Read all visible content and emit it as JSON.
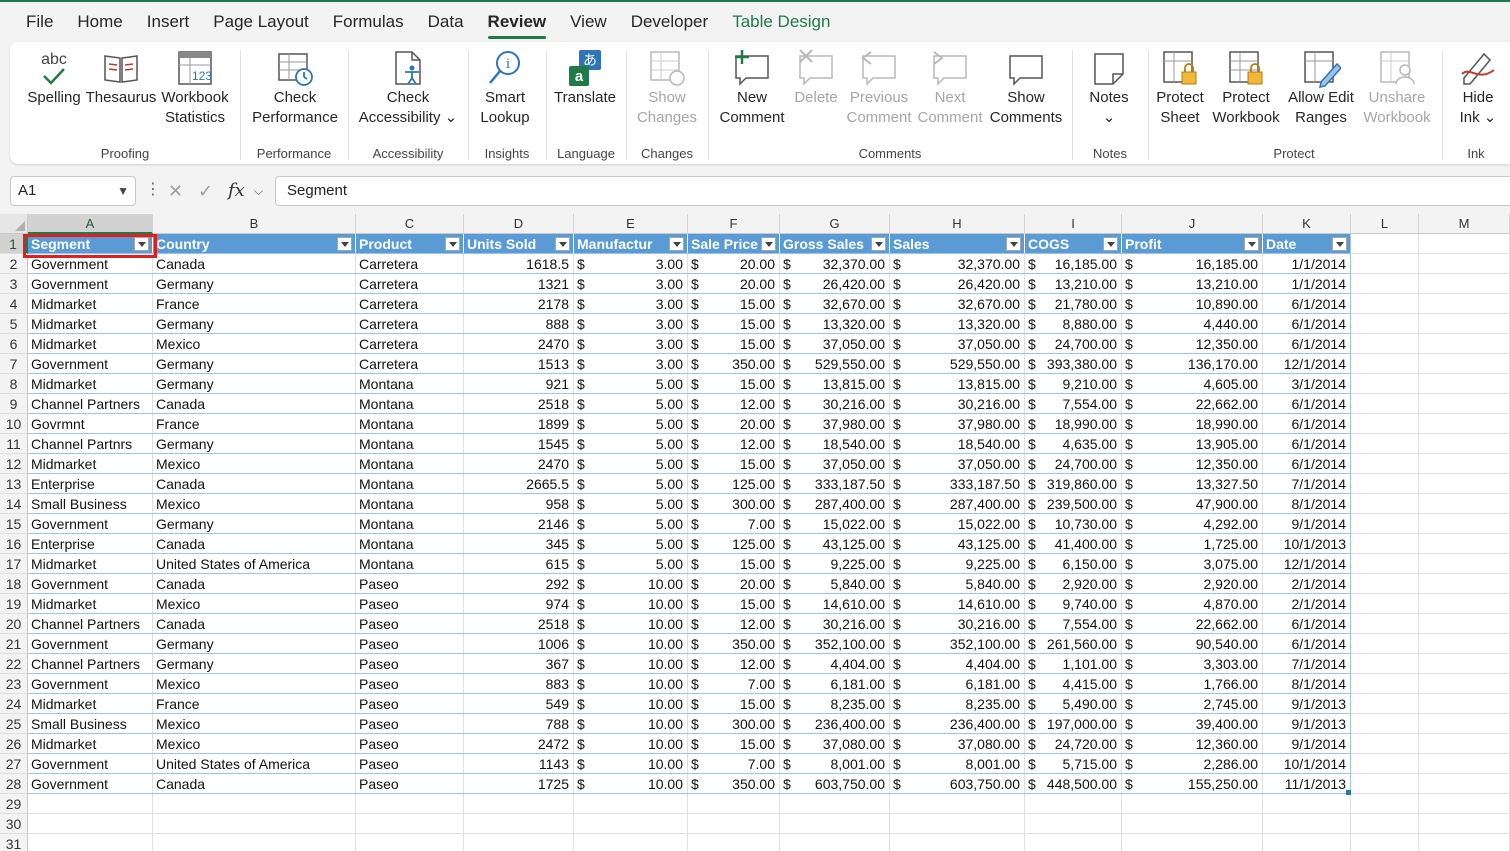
{
  "menu": {
    "tabs": [
      "File",
      "Home",
      "Insert",
      "Page Layout",
      "Formulas",
      "Data",
      "Review",
      "View",
      "Developer",
      "Table Design"
    ],
    "active": "Review",
    "contextual": "Table Design"
  },
  "ribbon": {
    "groups": {
      "proofing": "Proofing",
      "performance": "Performance",
      "accessibility": "Accessibility",
      "insights": "Insights",
      "language": "Language",
      "changes": "Changes",
      "comments": "Comments",
      "notes": "Notes",
      "protect": "Protect",
      "ink": "Ink"
    },
    "buttons": {
      "spelling": "Spelling",
      "thesaurus": "Thesaurus",
      "workbook_statistics_1": "Workbook",
      "workbook_statistics_2": "Statistics",
      "check_performance_1": "Check",
      "check_performance_2": "Performance",
      "check_accessibility_1": "Check",
      "check_accessibility_2": "Accessibility ⌄",
      "smart_lookup_1": "Smart",
      "smart_lookup_2": "Lookup",
      "translate": "Translate",
      "show_changes_1": "Show",
      "show_changes_2": "Changes",
      "new_comment_1": "New",
      "new_comment_2": "Comment",
      "delete": "Delete",
      "previous_comment_1": "Previous",
      "previous_comment_2": "Comment",
      "next_comment_1": "Next",
      "next_comment_2": "Comment",
      "show_comments_1": "Show",
      "show_comments_2": "Comments",
      "notes_1": "Notes",
      "notes_2": "⌄",
      "protect_sheet_1": "Protect",
      "protect_sheet_2": "Sheet",
      "protect_workbook_1": "Protect",
      "protect_workbook_2": "Workbook",
      "allow_edit_1": "Allow Edit",
      "allow_edit_2": "Ranges",
      "unshare_1": "Unshare",
      "unshare_2": "Workbook",
      "hide_ink_1": "Hide",
      "hide_ink_2": "Ink ⌄"
    },
    "thesaurus_icon_text": "abc",
    "stats_icon_text": "123"
  },
  "formula_bar": {
    "name_box": "A1",
    "fx": "fx",
    "content": "Segment"
  },
  "columns": [
    "A",
    "B",
    "C",
    "D",
    "E",
    "F",
    "G",
    "H",
    "I",
    "J",
    "K",
    "L",
    "M"
  ],
  "table": {
    "headers": [
      "Segment",
      "Country",
      "Product",
      "Units Sold",
      "Manufactur",
      "Sale Price",
      "Gross Sales",
      "Sales",
      "COGS",
      "Profit",
      "Date"
    ],
    "rows": [
      [
        "Government",
        "Canada",
        "Carretera",
        "1618.5",
        "3.00",
        "20.00",
        "32,370.00",
        "32,370.00",
        "16,185.00",
        "16,185.00",
        "1/1/2014"
      ],
      [
        "Government",
        "Germany",
        "Carretera",
        "1321",
        "3.00",
        "20.00",
        "26,420.00",
        "26,420.00",
        "13,210.00",
        "13,210.00",
        "1/1/2014"
      ],
      [
        "Midmarket",
        "France",
        "Carretera",
        "2178",
        "3.00",
        "15.00",
        "32,670.00",
        "32,670.00",
        "21,780.00",
        "10,890.00",
        "6/1/2014"
      ],
      [
        "Midmarket",
        "Germany",
        "Carretera",
        "888",
        "3.00",
        "15.00",
        "13,320.00",
        "13,320.00",
        "8,880.00",
        "4,440.00",
        "6/1/2014"
      ],
      [
        "Midmarket",
        "Mexico",
        "Carretera",
        "2470",
        "3.00",
        "15.00",
        "37,050.00",
        "37,050.00",
        "24,700.00",
        "12,350.00",
        "6/1/2014"
      ],
      [
        "Government",
        "Germany",
        "Carretera",
        "1513",
        "3.00",
        "350.00",
        "529,550.00",
        "529,550.00",
        "393,380.00",
        "136,170.00",
        "12/1/2014"
      ],
      [
        "Midmarket",
        "Germany",
        "Montana",
        "921",
        "5.00",
        "15.00",
        "13,815.00",
        "13,815.00",
        "9,210.00",
        "4,605.00",
        "3/1/2014"
      ],
      [
        "Channel Partners",
        "Canada",
        "Montana",
        "2518",
        "5.00",
        "12.00",
        "30,216.00",
        "30,216.00",
        "7,554.00",
        "22,662.00",
        "6/1/2014"
      ],
      [
        "Govrmnt",
        "France",
        "Montana",
        "1899",
        "5.00",
        "20.00",
        "37,980.00",
        "37,980.00",
        "18,990.00",
        "18,990.00",
        "6/1/2014"
      ],
      [
        "Channel Partnrs",
        "Germany",
        "Montana",
        "1545",
        "5.00",
        "12.00",
        "18,540.00",
        "18,540.00",
        "4,635.00",
        "13,905.00",
        "6/1/2014"
      ],
      [
        "Midmarket",
        "Mexico",
        "Montana",
        "2470",
        "5.00",
        "15.00",
        "37,050.00",
        "37,050.00",
        "24,700.00",
        "12,350.00",
        "6/1/2014"
      ],
      [
        "Enterprise",
        "Canada",
        "Montana",
        "2665.5",
        "5.00",
        "125.00",
        "333,187.50",
        "333,187.50",
        "319,860.00",
        "13,327.50",
        "7/1/2014"
      ],
      [
        "Small Business",
        "Mexico",
        "Montana",
        "958",
        "5.00",
        "300.00",
        "287,400.00",
        "287,400.00",
        "239,500.00",
        "47,900.00",
        "8/1/2014"
      ],
      [
        "Government",
        "Germany",
        "Montana",
        "2146",
        "5.00",
        "7.00",
        "15,022.00",
        "15,022.00",
        "10,730.00",
        "4,292.00",
        "9/1/2014"
      ],
      [
        "Enterprise",
        "Canada",
        "Montana",
        "345",
        "5.00",
        "125.00",
        "43,125.00",
        "43,125.00",
        "41,400.00",
        "1,725.00",
        "10/1/2013"
      ],
      [
        "Midmarket",
        "United States of America",
        "Montana",
        "615",
        "5.00",
        "15.00",
        "9,225.00",
        "9,225.00",
        "6,150.00",
        "3,075.00",
        "12/1/2014"
      ],
      [
        "Government",
        "Canada",
        "Paseo",
        "292",
        "10.00",
        "20.00",
        "5,840.00",
        "5,840.00",
        "2,920.00",
        "2,920.00",
        "2/1/2014"
      ],
      [
        "Midmarket",
        "Mexico",
        "Paseo",
        "974",
        "10.00",
        "15.00",
        "14,610.00",
        "14,610.00",
        "9,740.00",
        "4,870.00",
        "2/1/2014"
      ],
      [
        "Channel Partners",
        "Canada",
        "Paseo",
        "2518",
        "10.00",
        "12.00",
        "30,216.00",
        "30,216.00",
        "7,554.00",
        "22,662.00",
        "6/1/2014"
      ],
      [
        "Government",
        "Germany",
        "Paseo",
        "1006",
        "10.00",
        "350.00",
        "352,100.00",
        "352,100.00",
        "261,560.00",
        "90,540.00",
        "6/1/2014"
      ],
      [
        "Channel Partners",
        "Germany",
        "Paseo",
        "367",
        "10.00",
        "12.00",
        "4,404.00",
        "4,404.00",
        "1,101.00",
        "3,303.00",
        "7/1/2014"
      ],
      [
        "Government",
        "Mexico",
        "Paseo",
        "883",
        "10.00",
        "7.00",
        "6,181.00",
        "6,181.00",
        "4,415.00",
        "1,766.00",
        "8/1/2014"
      ],
      [
        "Midmarket",
        "France",
        "Paseo",
        "549",
        "10.00",
        "15.00",
        "8,235.00",
        "8,235.00",
        "5,490.00",
        "2,745.00",
        "9/1/2013"
      ],
      [
        "Small Business",
        "Mexico",
        "Paseo",
        "788",
        "10.00",
        "300.00",
        "236,400.00",
        "236,400.00",
        "197,000.00",
        "39,400.00",
        "9/1/2013"
      ],
      [
        "Midmarket",
        "Mexico",
        "Paseo",
        "2472",
        "10.00",
        "15.00",
        "37,080.00",
        "37,080.00",
        "24,720.00",
        "12,360.00",
        "9/1/2014"
      ],
      [
        "Government",
        "United States of America",
        "Paseo",
        "1143",
        "10.00",
        "7.00",
        "8,001.00",
        "8,001.00",
        "5,715.00",
        "2,286.00",
        "10/1/2014"
      ],
      [
        "Government",
        "Canada",
        "Paseo",
        "1725",
        "10.00",
        "350.00",
        "603,750.00",
        "603,750.00",
        "448,500.00",
        "155,250.00",
        "11/1/2013"
      ]
    ],
    "currency_symbol": "$",
    "currency_columns": [
      4,
      5,
      6,
      7,
      8,
      9
    ],
    "right_aligned_columns": [
      3,
      10
    ]
  },
  "row_numbers": [
    "1",
    "2",
    "3",
    "4",
    "5",
    "6",
    "7",
    "8",
    "9",
    "10",
    "11",
    "12",
    "13",
    "14",
    "15",
    "16",
    "17",
    "18",
    "19",
    "20",
    "21",
    "22",
    "23",
    "24",
    "25",
    "26",
    "27",
    "28",
    "29",
    "30",
    "31"
  ],
  "selected_cell": "A1",
  "colors": {
    "accent": "#1f7a47",
    "table_header": "#5b9bd5",
    "selection_highlight": "#e0201e"
  }
}
